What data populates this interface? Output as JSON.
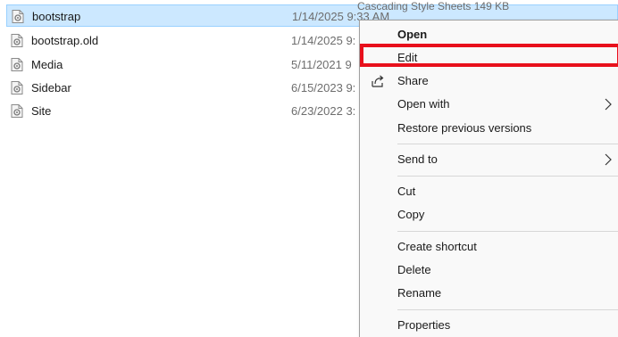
{
  "files": [
    {
      "name": "bootstrap",
      "date": "1/14/2025 9:33 AM",
      "extra": "Cascading Style Sheets       149 KB",
      "selected": true
    },
    {
      "name": "bootstrap.old",
      "date": "1/14/2025 9:",
      "extra": "",
      "selected": false
    },
    {
      "name": "Media",
      "date": "5/11/2021 9",
      "extra": "",
      "selected": false
    },
    {
      "name": "Sidebar",
      "date": "6/15/2023 9:",
      "extra": "",
      "selected": false
    },
    {
      "name": "Site",
      "date": "6/23/2022 3:",
      "extra": "",
      "selected": false
    }
  ],
  "context_menu": {
    "open": "Open",
    "edit": "Edit",
    "share": "Share",
    "open_with": "Open with",
    "restore": "Restore previous versions",
    "send_to": "Send to",
    "cut": "Cut",
    "copy": "Copy",
    "create_shortcut": "Create shortcut",
    "delete": "Delete",
    "rename": "Rename",
    "properties": "Properties"
  },
  "colors": {
    "selection": "#cce8ff",
    "highlight": "#e8101c"
  },
  "icons": {
    "file": "css-file-icon",
    "share": "share-icon",
    "submenu": "chevron-right-icon"
  }
}
